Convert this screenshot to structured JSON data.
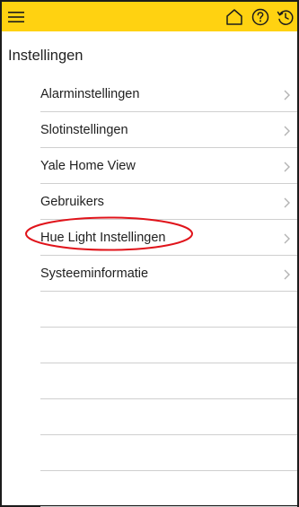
{
  "header": {
    "background_color": "#ffd211",
    "icons": [
      "hamburger-menu-icon",
      "home-icon",
      "help-circle-icon",
      "history-icon"
    ]
  },
  "page": {
    "title": "Instellingen"
  },
  "settings": {
    "items": [
      {
        "label": "Alarminstellingen"
      },
      {
        "label": "Slotinstellingen"
      },
      {
        "label": "Yale Home View"
      },
      {
        "label": "Gebruikers"
      },
      {
        "label": "Hue Light Instellingen",
        "highlighted": true
      },
      {
        "label": "Systeeminformatie"
      }
    ],
    "highlight_color": "#e0131a"
  }
}
